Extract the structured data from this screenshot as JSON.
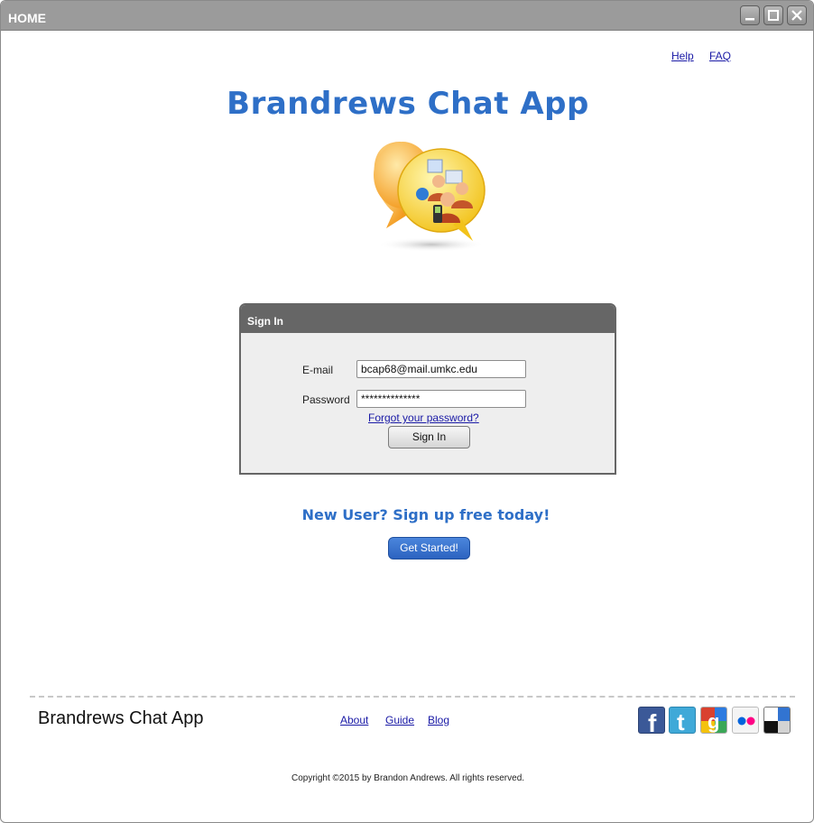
{
  "window": {
    "title": "HOME",
    "buttons": [
      "minimize-icon",
      "maximize-icon",
      "close-icon"
    ]
  },
  "header": {
    "links": [
      "Help",
      "FAQ"
    ],
    "app_title": "Brandrews Chat App",
    "logo_icon": "chat-bubbles-people-icon"
  },
  "signin": {
    "panel_title": "Sign In",
    "email_label": "E-mail",
    "email_value": "bcap68@mail.umkc.edu",
    "password_label": "Password",
    "password_value": "**************",
    "forgot_link": "Forgot your password?",
    "button_label": "Sign In"
  },
  "signup": {
    "prompt": "New User?  Sign up free today!",
    "button_label": "Get Started!"
  },
  "footer": {
    "title": "Brandrews Chat App",
    "links": [
      "About",
      "Guide",
      "Blog"
    ],
    "social": [
      "facebook-icon",
      "twitter-icon",
      "google-icon",
      "flickr-icon",
      "delicious-icon"
    ],
    "copyright": "Copyright ©2015 by Brandon Andrews. All rights reserved."
  },
  "colors": {
    "accent_blue": "#2e6fc7",
    "titlebar": "#9b9b9b",
    "panel_header": "#666666",
    "panel_body": "#eeeeee",
    "link": "#1a1aa6"
  }
}
